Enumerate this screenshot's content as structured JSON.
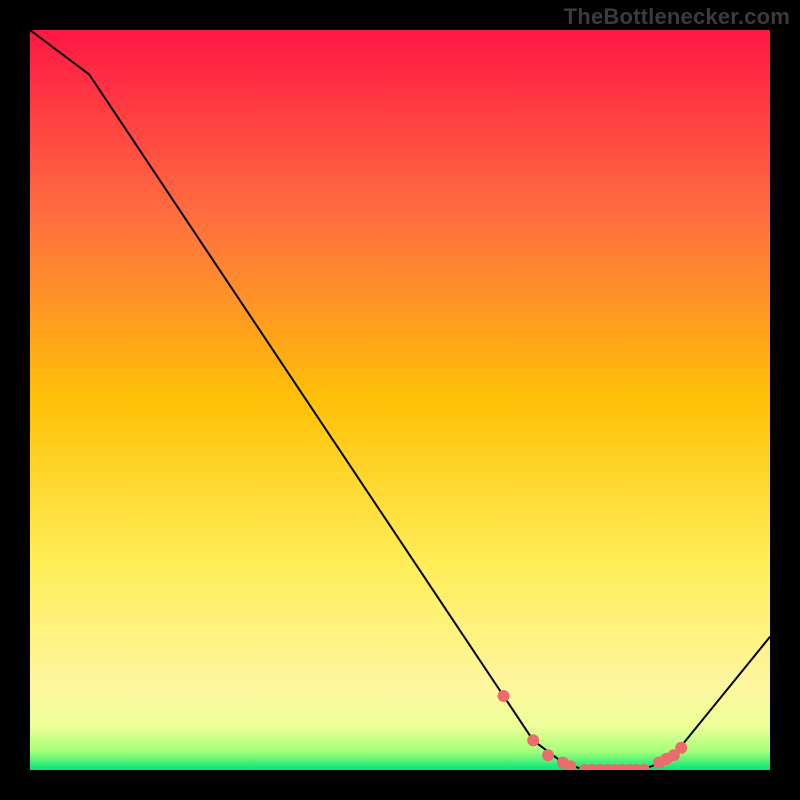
{
  "watermark": "TheBottlenecker.com",
  "chart_data": {
    "type": "line",
    "title": "",
    "xlabel": "",
    "ylabel": "",
    "xlim": [
      0,
      100
    ],
    "ylim": [
      0,
      100
    ],
    "x": [
      0,
      8,
      64,
      68,
      72,
      75,
      78,
      80,
      82,
      84,
      87,
      100
    ],
    "values": [
      100,
      94,
      10,
      4,
      1,
      0,
      0,
      0,
      0,
      0.5,
      2,
      18
    ],
    "marker_points_x": [
      64,
      68,
      70,
      72,
      73,
      75,
      76,
      77,
      78,
      79,
      80,
      81,
      82,
      83,
      85,
      86,
      87,
      88
    ],
    "marker_points_y": [
      10,
      4,
      2,
      1,
      0.5,
      0,
      0,
      0,
      0,
      0,
      0,
      0,
      0,
      0,
      1,
      1.5,
      2,
      3
    ],
    "gradient_stops": [
      {
        "offset": 0.0,
        "color": "#ff1744"
      },
      {
        "offset": 0.25,
        "color": "#ff6e40"
      },
      {
        "offset": 0.5,
        "color": "#ffc107"
      },
      {
        "offset": 0.72,
        "color": "#ffee58"
      },
      {
        "offset": 0.88,
        "color": "#fff59d"
      },
      {
        "offset": 0.94,
        "color": "#eeff99"
      },
      {
        "offset": 0.975,
        "color": "#a5ff7a"
      },
      {
        "offset": 1.0,
        "color": "#00e676"
      }
    ],
    "curve_color": "#000000",
    "marker_color": "#ec6b6b"
  }
}
